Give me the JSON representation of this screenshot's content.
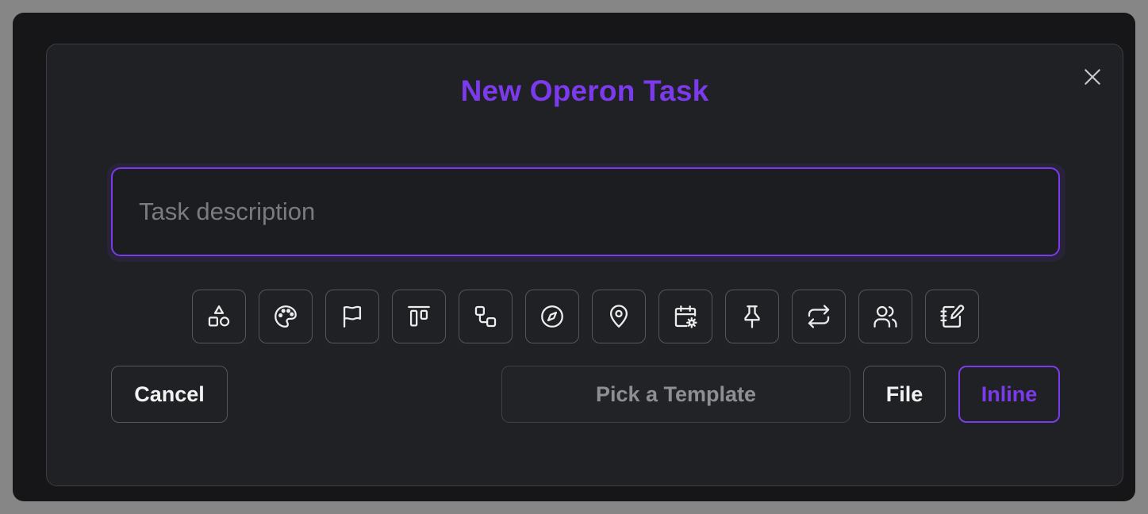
{
  "dialog": {
    "title": "New Operon Task",
    "close_icon": "x-icon"
  },
  "task_input": {
    "value": "",
    "placeholder": "Task description"
  },
  "toolbar_icons": [
    "shapes-icon",
    "palette-icon",
    "flag-icon",
    "align-top-icon",
    "workflow-icon",
    "compass-icon",
    "map-pin-icon",
    "calendar-settings-icon",
    "pin-icon",
    "repeat-icon",
    "users-icon",
    "notebook-pen-icon"
  ],
  "actions": {
    "cancel_label": "Cancel",
    "template_label": "Pick a Template",
    "file_label": "File",
    "inline_label": "Inline"
  },
  "colors": {
    "accent": "#7c3aed",
    "dialog_bg": "#202125",
    "backdrop": "#868686"
  }
}
